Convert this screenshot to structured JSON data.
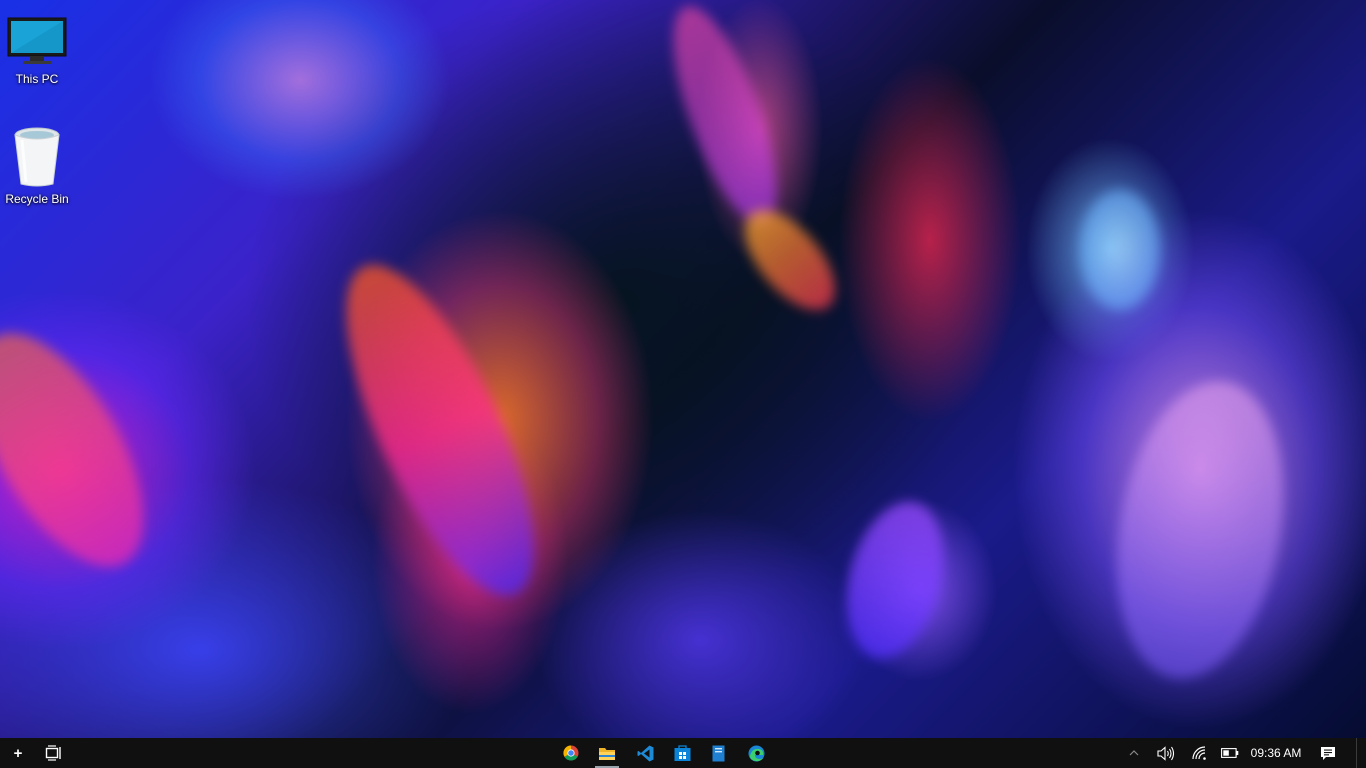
{
  "desktop": {
    "icons": [
      {
        "label": "This PC",
        "icon": "this-pc-icon"
      },
      {
        "label": "Recycle Bin",
        "icon": "recycle-bin-icon"
      }
    ]
  },
  "taskbar": {
    "left": [
      {
        "name": "start-button",
        "icon": "plus-icon"
      },
      {
        "name": "task-view-button",
        "icon": "task-view-icon"
      }
    ],
    "apps": [
      {
        "name": "Google Chrome",
        "icon": "chrome-icon",
        "active": false
      },
      {
        "name": "File Explorer",
        "icon": "file-explorer-icon",
        "active": true
      },
      {
        "name": "Visual Studio Code",
        "icon": "vscode-icon",
        "active": false
      },
      {
        "name": "Microsoft Store",
        "icon": "store-icon",
        "active": false
      },
      {
        "name": "Notes",
        "icon": "notes-icon",
        "active": false
      },
      {
        "name": "Microsoft Edge",
        "icon": "edge-icon",
        "active": false
      }
    ],
    "tray": {
      "chevron_icon": "chevron-up-icon",
      "volume_icon": "volume-icon",
      "network_icon": "wifi-icon",
      "battery_icon": "battery-icon",
      "time": "09:36 AM",
      "notifications_icon": "action-center-icon"
    }
  },
  "colors": {
    "taskbar_bg": "#101010",
    "active_indicator": "#9aa4ad",
    "accent": "#0a84d8"
  }
}
